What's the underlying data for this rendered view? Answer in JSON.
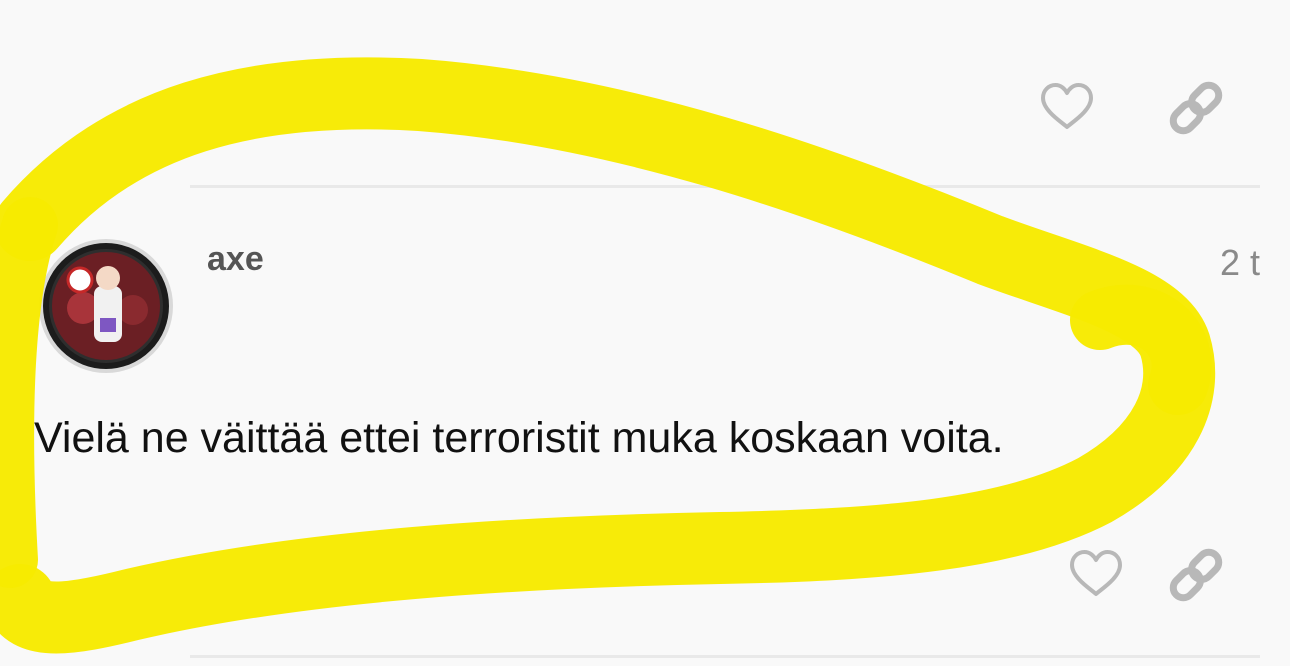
{
  "post": {
    "username": "axe",
    "timestamp": "2 t",
    "text": "Vielä ne väittää ettei terroristit muka koskaan voita."
  },
  "icons": {
    "like": "heart-icon",
    "share": "link-icon"
  },
  "colors": {
    "background": "#f9f9f9",
    "highlight": "#f7ea00",
    "icon": "#b8b8b8",
    "username": "#555555",
    "timestamp": "#8a8a8a",
    "text": "#111111"
  }
}
